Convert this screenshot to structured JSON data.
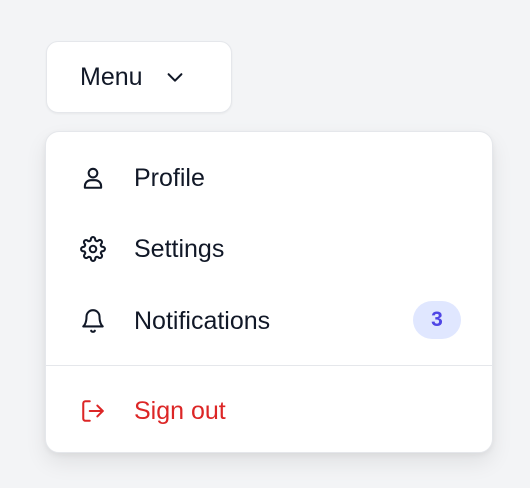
{
  "trigger": {
    "label": "Menu",
    "chevron_icon": "chevron-down-icon"
  },
  "menu": {
    "items": [
      {
        "label": "Profile",
        "icon": "user-icon"
      },
      {
        "label": "Settings",
        "icon": "gear-icon"
      },
      {
        "label": "Notifications",
        "icon": "bell-icon",
        "badge": "3"
      }
    ],
    "sign_out": {
      "label": "Sign out",
      "icon": "sign-out-icon"
    }
  },
  "colors": {
    "background": "#f3f4f6",
    "surface": "#ffffff",
    "text": "#111827",
    "danger": "#dc2626",
    "badge_bg": "#e0e7ff",
    "badge_text": "#4f46e5"
  }
}
